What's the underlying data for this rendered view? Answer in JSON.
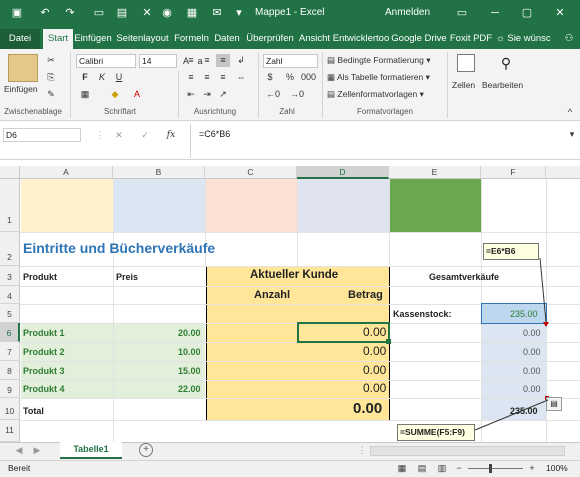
{
  "app": {
    "title": "Mappe1 - Excel",
    "signin": "Anmelden"
  },
  "tabs": [
    "Datei",
    "Start",
    "Einfügen",
    "Seitenlayout",
    "Formeln",
    "Daten",
    "Überprüfen",
    "Ansicht",
    "Entwicklertoo",
    "Google Drive",
    "Foxit PDF"
  ],
  "tell_me": "Sie wünsc",
  "ribbon": {
    "paste_label": "Einfügen",
    "font_name": "Calibri",
    "font_size": "14",
    "number_format": "Zahl",
    "cond_format": "Bedingte Formatierung",
    "as_table": "Als Tabelle formatieren",
    "cell_styles": "Zellenformatvorlagen",
    "cells_label": "Zellen",
    "edit_label": "Bearbeiten",
    "groups": [
      "Zwischenablage",
      "Schriftart",
      "Ausrichtung",
      "Zahl",
      "Formatvorlagen"
    ]
  },
  "formula_bar": {
    "name_box": "D6",
    "formula": "=C6*B6"
  },
  "columns": [
    "A",
    "B",
    "C",
    "D",
    "E",
    "F"
  ],
  "rows": [
    "1",
    "2",
    "3",
    "4",
    "5",
    "6",
    "7",
    "8",
    "9",
    "10",
    "11"
  ],
  "sheet": {
    "title": "Eintritte und Bücherverkäufe",
    "hdr_produkt": "Produkt",
    "hdr_preis": "Preis",
    "current_customer": "Aktueller Kunde",
    "anzahl": "Anzahl",
    "betrag": "Betrag",
    "gesamtverkaeufe": "Gesamtverkäufe",
    "kassenstock_label": "Kassenstock:",
    "kassenstock_value": "235.00",
    "products": [
      {
        "name": "Produkt 1",
        "price": "20.00",
        "amount": "0.00",
        "total": "0.00"
      },
      {
        "name": "Produkt 2",
        "price": "10.00",
        "amount": "0.00",
        "total": "0.00"
      },
      {
        "name": "Produkt 3",
        "price": "15.00",
        "amount": "0.00",
        "total": "0.00"
      },
      {
        "name": "Produkt 4",
        "price": "22.00",
        "amount": "0.00",
        "total": "0.00"
      }
    ],
    "total_label": "Total",
    "total_amount": "0.00",
    "total_sales": "235.00",
    "tip_e6b6": "=E6*B6",
    "tip_sum": "=SUMME(F5:F9)"
  },
  "sheet_tab": "Tabelle1",
  "status": {
    "ready": "Bereit",
    "zoom": "100%"
  },
  "colors": {
    "accent": "#217346"
  }
}
